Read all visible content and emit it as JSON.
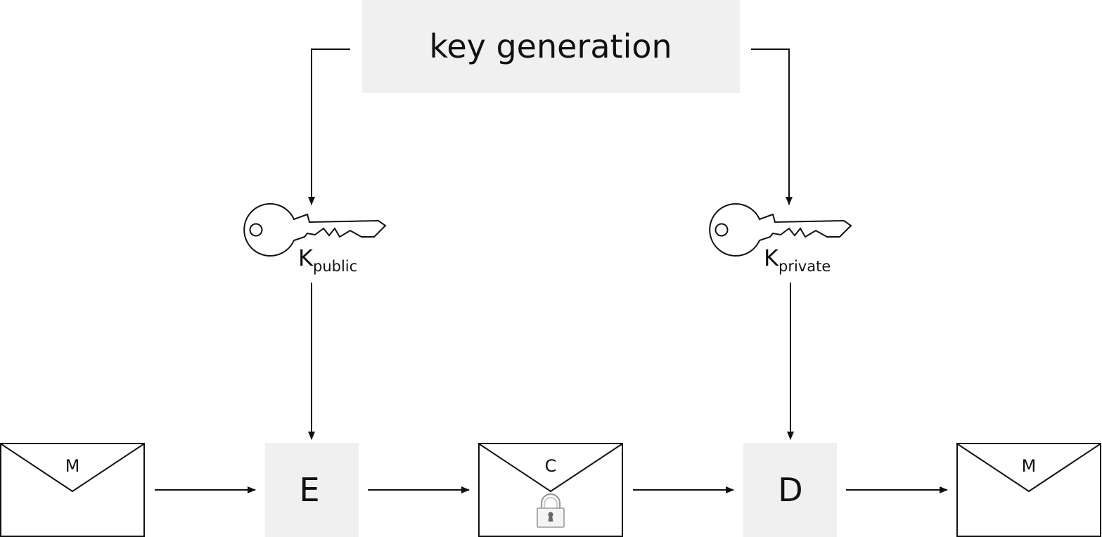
{
  "diagram": {
    "key_generation": {
      "label": "key generation"
    },
    "public_key": {
      "label_main": "K",
      "label_sub": "public"
    },
    "private_key": {
      "label_main": "K",
      "label_sub": "private"
    },
    "encrypt": {
      "label": "E"
    },
    "decrypt": {
      "label": "D"
    },
    "plaintext_in": {
      "label": "M"
    },
    "ciphertext": {
      "label": "C"
    },
    "plaintext_out": {
      "label": "M"
    }
  },
  "colors": {
    "box_fill": "#f0f0f0",
    "stroke": "#111111",
    "lock": "#9a9a9a"
  }
}
